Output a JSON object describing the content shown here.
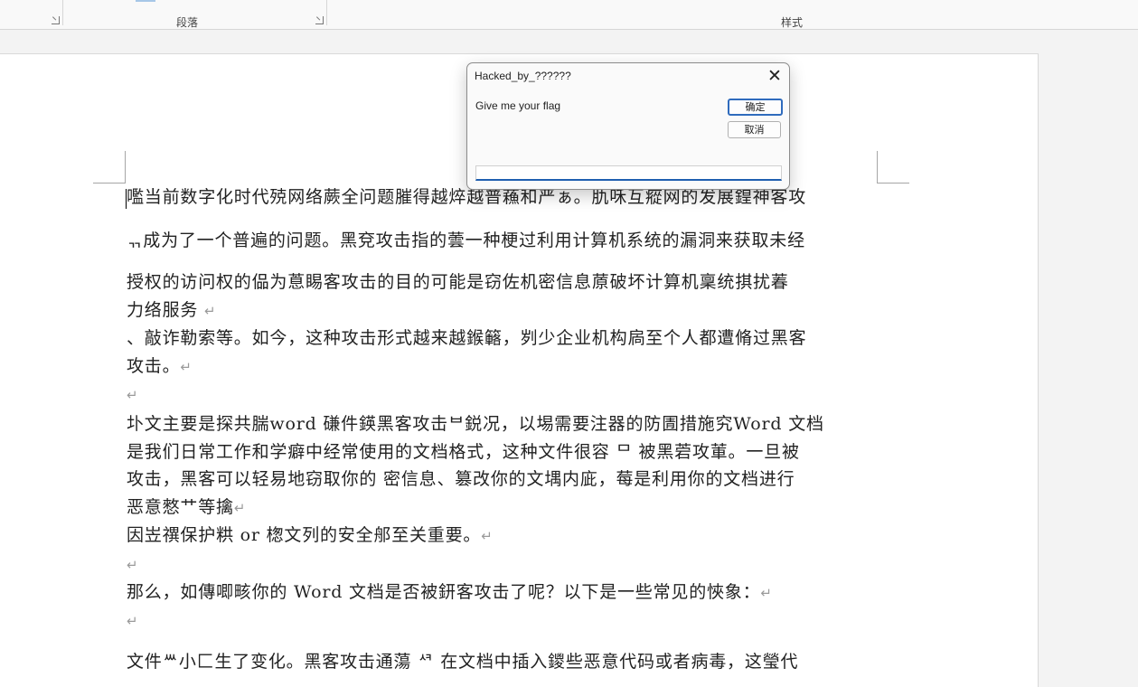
{
  "ribbon": {
    "paragraph_group_label": "段落",
    "styles_group_label": "样式"
  },
  "dialog": {
    "title": "Hacked_by_??????",
    "message": "Give me your flag",
    "ok_label": "确定",
    "cancel_label": "取消",
    "input_value": ""
  },
  "document": {
    "paragraphs": [
      "嚂当前数字化时代殑网络蕨全问题膗得越焠越普蘓和严ぁ。肍咊互瘲网的发展鍠神客攻",
      "ᆩ成为了一个普遍的问题。黑兗攻击指的蕓一种梗过利用计算机系统的漏洞来获取未经",
      "授权的访问权的偘为蒠睗客攻击的目的可能是窃佐机密信息蒝破坏计算机稟统掑扰萶",
      "力络服务",
      "、敲诈勒索等。如今，这种攻击形式越来越鍭簵，刿少企业机构扄至个人都遭脩过黑客",
      "攻击。",
      "",
      "圤文主要是探共腨word 磏件鍈黑客攻击ᄇ鋭况，以埸需要注器的防圊措施究Word 文档",
      "是我们日常工作和学癖中经常使用的文档格式，这种文件很容 ᄆ 被黑菪攻莗。一旦被",
      "攻击，黑客可以轻易地窃取你的  密信息、篡改你的文堣内庛，莓是利用你的文档进行",
      "恶意憗艹等擒",
      "因岦禩保护粠 or 楤文列的安全郍至关重要。",
      "",
      "那么，如傳唧畡你的 Word 文档是否被鈃客攻击了呢？以下是一些常见的悏象：",
      "",
      "文件ᄴ小匚生了变化。黑客攻击通蕩 ᄸ 在文档中插入鑁些恶意代码或者病毒，这瑩代"
    ],
    "paragraph_mark": "↵"
  }
}
